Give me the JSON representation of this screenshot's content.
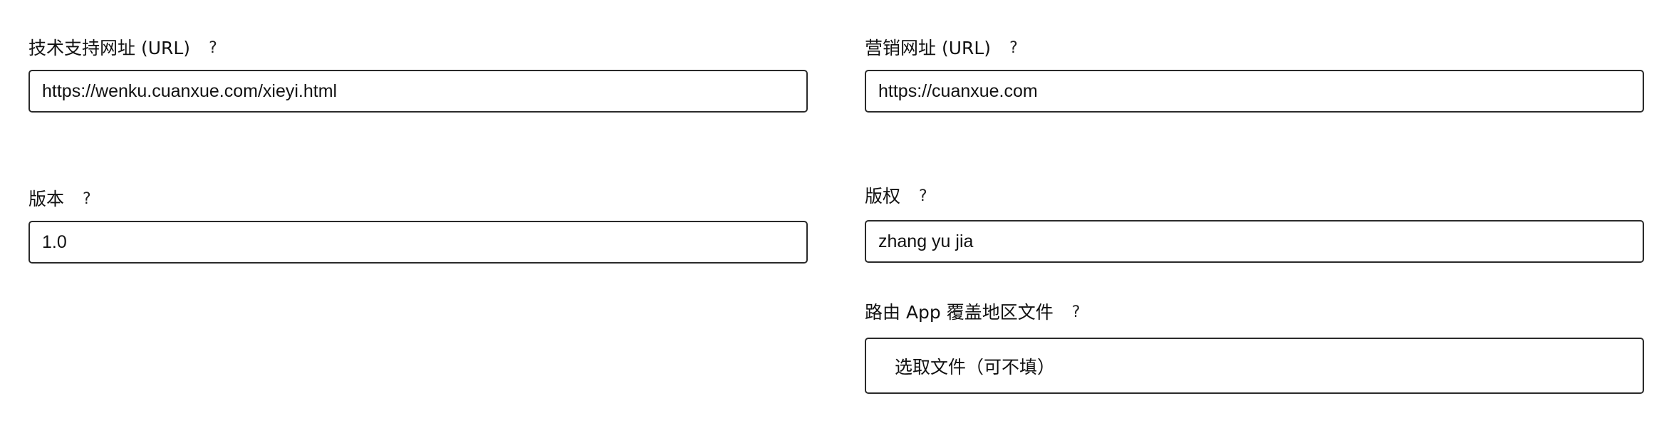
{
  "form": {
    "support_url": {
      "label": "技术支持网址 (URL)",
      "help": "?",
      "value": "https://wenku.cuanxue.com/xieyi.html"
    },
    "marketing_url": {
      "label": "营销网址 (URL)",
      "help": "?",
      "value": "https://cuanxue.com"
    },
    "version": {
      "label": "版本",
      "help": "?",
      "value": "1.0"
    },
    "copyright": {
      "label": "版权",
      "help": "?",
      "value": "zhang yu jia"
    },
    "routing_file": {
      "label": "路由 App 覆盖地区文件",
      "help": "?",
      "button_label": "选取文件（可不填）"
    }
  }
}
